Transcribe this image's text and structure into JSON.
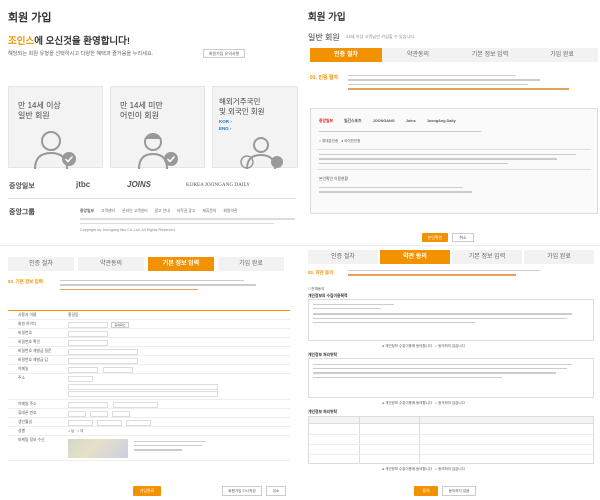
{
  "left": {
    "title": "회원 가입",
    "welcome_brand": "조인스",
    "welcome_rest": "에 오신것을 환영합니다!",
    "subtitle": "해당되는 회원 유형을 선택하시고 다양한 혜택과 즐거움을 누리세요.",
    "guide_button": "회원가입 유의사항",
    "cards": [
      {
        "line1": "만 14세 이상",
        "line2": "일반 회원"
      },
      {
        "line1": "만 14세 미만",
        "line2": "어린이 회원"
      },
      {
        "line1": "해외거주국민",
        "line2": "및 외국인 회원",
        "link1": "KOR ›",
        "link2": "ENG ›"
      }
    ],
    "logos": [
      "중앙일보",
      "jtbc",
      "JOINS",
      "KOREA JOONGANG DAILY"
    ],
    "footer_brand": "중앙그룹",
    "footer_links": [
      "중앙일보",
      "고객센터",
      "온라인 고객센터",
      "광고 안내",
      "저작권 광고",
      "제휴문의",
      "회원약관"
    ],
    "footer_copy": "Copyright by Joongang Ilbo Co.,Ltd. All Rights Reserved."
  },
  "right": {
    "title": "회원 가입",
    "section_title": "일반 회원",
    "section_desc": "14세 이상 고객님만 가입할 수 있습니다.",
    "steps": [
      "인증 절차",
      "약관동의",
      "기본 정보 입력",
      "가입 완료"
    ],
    "auth_heading": "01. 인증 절차",
    "verify_title": "본인확인 이용현황",
    "confirm_button": "본인확인",
    "cancel_button": "취소"
  },
  "bottom_left": {
    "steps": [
      "인증 절차",
      "약관동의",
      "기본 정보 입력",
      "가입 완료"
    ],
    "heading": "03. 기본 정보 입력",
    "form_labels": [
      "사용자 이름",
      "회원 아이디",
      "비밀번호",
      "비밀번호 확인",
      "비밀번호 재발급 질문",
      "비밀번호 재발급 답",
      "이메일",
      "주소",
      "이메일 주소",
      "휴대폰 번호",
      "생년월일",
      "성별",
      "마케팅 정보 수신"
    ],
    "name_value": "홍길동",
    "dup_check": "중복확인",
    "submit_button": "가입완료",
    "reset_button": "회원가입 다시작성",
    "cancel_button": "취소"
  },
  "bottom_right": {
    "steps": [
      "인증 절차",
      "약관 동의",
      "기본 정보 입력",
      "가입 완료"
    ],
    "heading": "02. 약관 동의",
    "agree_all": "전체동의",
    "sections": [
      "개인정보의 수집이용목적",
      "개인정보 처리위탁",
      "개인정보 처리위탁"
    ],
    "agree_label": "개인정보 수집이용에 동의합니다",
    "disagree_label": "동의하지 않습니다",
    "next_button": "동의",
    "cancel_button": "동의하지 않음"
  }
}
